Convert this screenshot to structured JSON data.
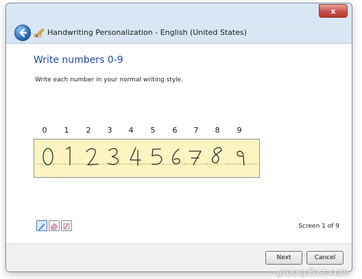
{
  "window": {
    "title": "Handwriting Personalization - English (United States)",
    "close_label": "x"
  },
  "page": {
    "heading": "Write numbers 0-9",
    "instruction": "Write each number in your normal writing style."
  },
  "digits": [
    "0",
    "1",
    "2",
    "3",
    "4",
    "5",
    "6",
    "7",
    "8",
    "9"
  ],
  "screen_counter": "Screen 1 of 9",
  "buttons": {
    "next": "Next",
    "cancel": "Cancel"
  },
  "watermark": "groovyPost.com",
  "colors": {
    "heading": "#1f4aa0",
    "pad_background": "#fdf4c2"
  },
  "icons": {
    "back": "back-arrow-icon",
    "app": "pen-icon",
    "pen_tool": "pen-tool-icon",
    "eraser_tool": "eraser-icon",
    "clear_tool": "clear-icon"
  }
}
